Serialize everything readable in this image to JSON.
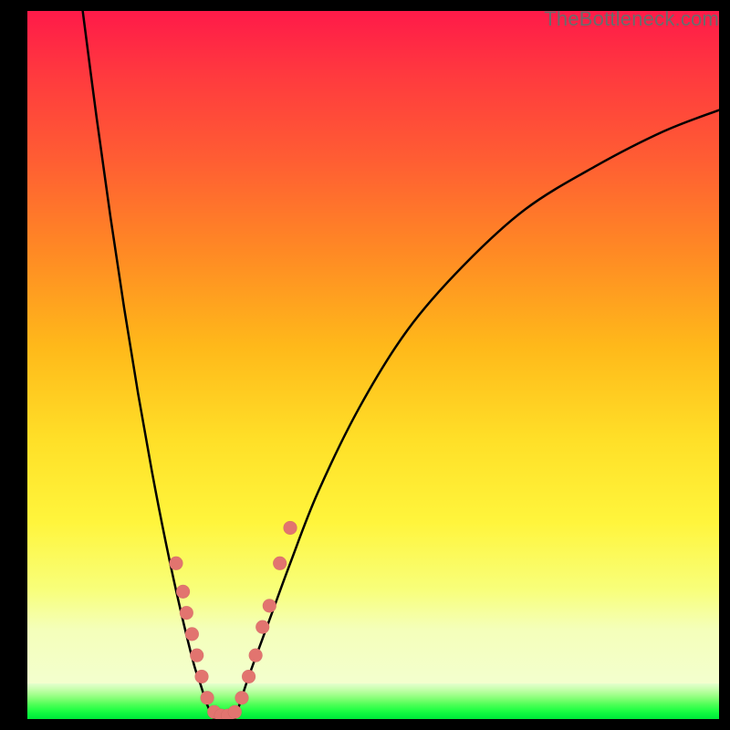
{
  "watermark": "TheBottleneck.com",
  "chart_data": {
    "type": "line",
    "title": "",
    "xlabel": "",
    "ylabel": "",
    "xlim": [
      0,
      100
    ],
    "ylim": [
      0,
      100
    ],
    "background": "rainbow-gradient",
    "series": [
      {
        "name": "left-curve",
        "x": [
          8,
          10,
          12,
          14,
          16,
          18,
          20,
          22,
          24,
          25,
          26,
          27
        ],
        "y": [
          100,
          85,
          71,
          58,
          46,
          35,
          25,
          16,
          8,
          5,
          2,
          0
        ]
      },
      {
        "name": "right-curve",
        "x": [
          30,
          32,
          35,
          38,
          42,
          48,
          55,
          63,
          72,
          82,
          92,
          100
        ],
        "y": [
          0,
          6,
          14,
          22,
          32,
          44,
          55,
          64,
          72,
          78,
          83,
          86
        ]
      }
    ],
    "markers": [
      {
        "x": 21.5,
        "y": 22
      },
      {
        "x": 22.5,
        "y": 18
      },
      {
        "x": 23.0,
        "y": 15
      },
      {
        "x": 23.8,
        "y": 12
      },
      {
        "x": 24.5,
        "y": 9
      },
      {
        "x": 25.2,
        "y": 6
      },
      {
        "x": 26.0,
        "y": 3
      },
      {
        "x": 27.0,
        "y": 1
      },
      {
        "x": 28.0,
        "y": 0.5
      },
      {
        "x": 29.0,
        "y": 0.5
      },
      {
        "x": 30.0,
        "y": 1
      },
      {
        "x": 31.0,
        "y": 3
      },
      {
        "x": 32.0,
        "y": 6
      },
      {
        "x": 33.0,
        "y": 9
      },
      {
        "x": 34.0,
        "y": 13
      },
      {
        "x": 35.0,
        "y": 16
      },
      {
        "x": 36.5,
        "y": 22
      },
      {
        "x": 38.0,
        "y": 27
      }
    ],
    "marker_color": "#e2746f",
    "curve_color": "#000000"
  }
}
